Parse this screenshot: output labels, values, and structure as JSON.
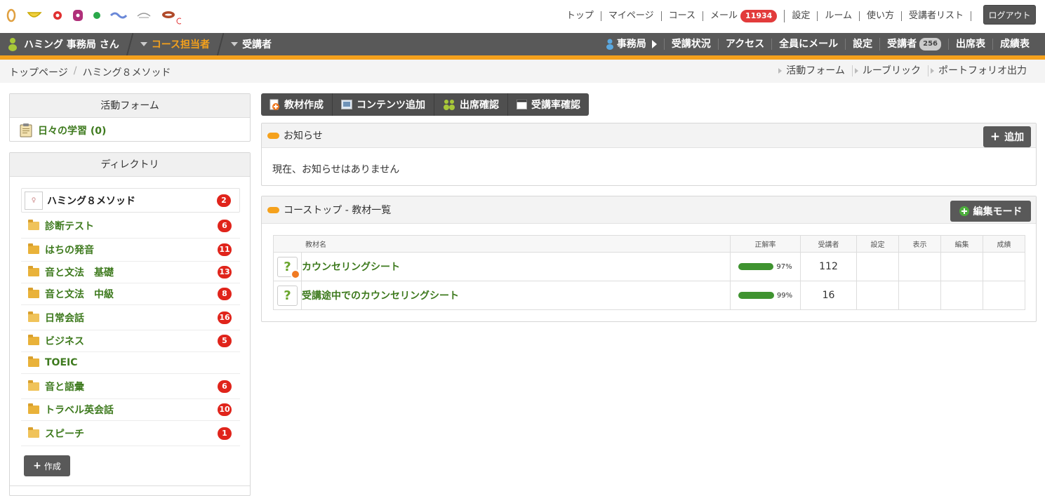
{
  "top": {
    "links": [
      {
        "label": "トップ"
      },
      {
        "label": "マイページ"
      },
      {
        "label": "コース"
      },
      {
        "label": "メール",
        "badge": "11934"
      },
      {
        "label": "設定"
      },
      {
        "label": "ルーム"
      },
      {
        "label": "使い方"
      },
      {
        "label": "受講者リスト"
      }
    ],
    "logout_label": "ログアウト"
  },
  "nav": {
    "user": "ハミング 事務局 さん",
    "role_current": "コース担当者",
    "role_other": "受講者",
    "office": "事務局",
    "items": [
      {
        "label": "受講状況"
      },
      {
        "label": "アクセス"
      },
      {
        "label": "全員にメール"
      },
      {
        "label": "設定"
      },
      {
        "label": "受講者",
        "badge": "256"
      },
      {
        "label": "出席表"
      },
      {
        "label": "成績表"
      }
    ],
    "accent_color": "#f5a11c"
  },
  "breadcrumb": {
    "items": [
      "トップページ",
      "ハミング８メソッド"
    ],
    "separator": "/",
    "links": [
      "活動フォーム",
      "ルーブリック",
      "ポートフォリオ出力"
    ]
  },
  "form_panel": {
    "title": "活動フォーム",
    "item": "日々の学習 (0)"
  },
  "directory": {
    "title": "ディレクトリ",
    "root": {
      "label": "ハミング８メソッド",
      "count": "2"
    },
    "items": [
      {
        "label": "診断テスト",
        "count": "6",
        "open": true
      },
      {
        "label": "はちの発音",
        "count": "11",
        "open": false
      },
      {
        "label": "音と文法　基礎",
        "count": "13",
        "open": false
      },
      {
        "label": "音と文法　中級",
        "count": "8",
        "open": false
      },
      {
        "label": "日常会話",
        "count": "16",
        "open": true
      },
      {
        "label": "ビジネス",
        "count": "5",
        "open": false
      },
      {
        "label": "TOEIC",
        "count": "",
        "open": false
      },
      {
        "label": "音と語彙",
        "count": "6",
        "open": true
      },
      {
        "label": "トラベル英会話",
        "count": "10",
        "open": false
      },
      {
        "label": "スピーチ",
        "count": "1",
        "open": true
      }
    ],
    "create_label": "作成"
  },
  "toolbar": {
    "buttons": [
      {
        "label": "教材作成",
        "icon": "material-create-icon"
      },
      {
        "label": "コンテンツ追加",
        "icon": "content-add-icon"
      },
      {
        "label": "出席確認",
        "icon": "attendance-icon"
      },
      {
        "label": "受講率確認",
        "icon": "rate-icon"
      }
    ]
  },
  "notice": {
    "title": "お知らせ",
    "add_label": "追加",
    "body": "現在、お知らせはありません"
  },
  "course": {
    "title": "コーストップ - 教材一覧",
    "edit_label": "編集モード",
    "columns": [
      "教材名",
      "正解率",
      "受講者",
      "設定",
      "表示",
      "編集",
      "成績"
    ],
    "rows": [
      {
        "name": "カウンセリングシート",
        "rate": 0.97,
        "rate_label": "97%",
        "students": "112"
      },
      {
        "name": "受講途中でのカウンセリングシート",
        "rate": 0.99,
        "rate_label": "99%",
        "students": "16"
      }
    ]
  }
}
